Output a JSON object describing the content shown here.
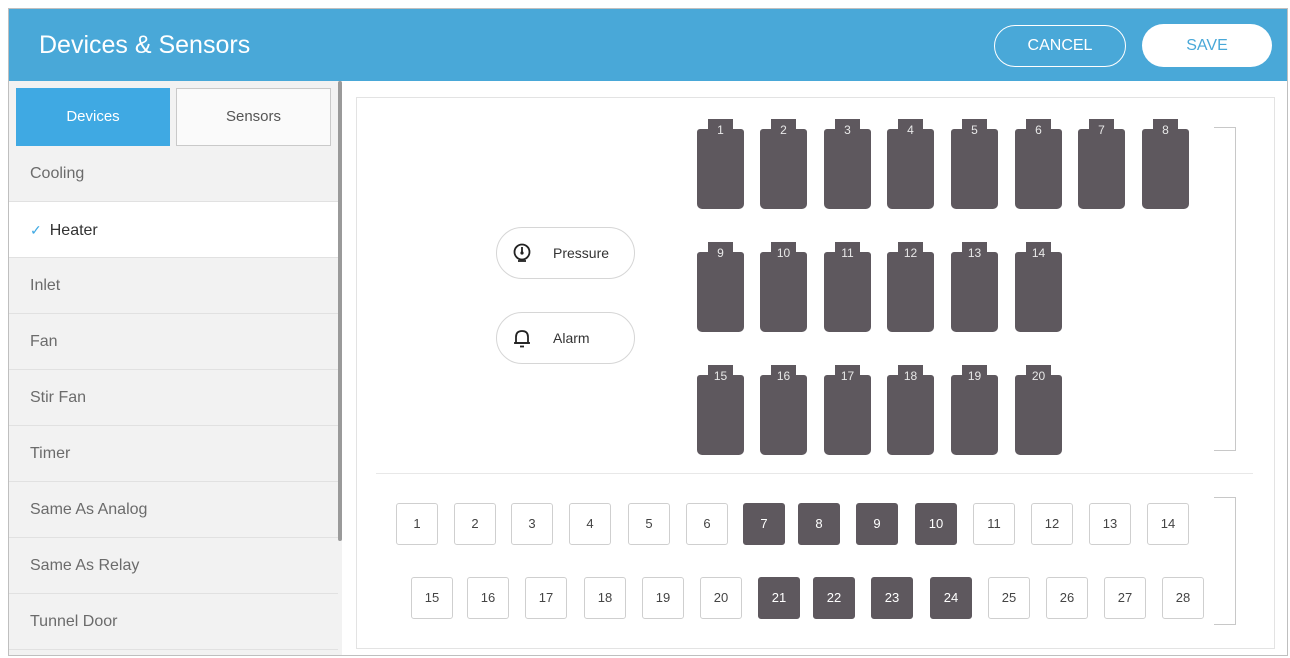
{
  "header": {
    "title": "Devices & Sensors",
    "cancel_label": "CANCEL",
    "save_label": "SAVE"
  },
  "colors": {
    "header_bg": "#49a8d8",
    "active_tab": "#3fa9e3",
    "device_fill": "#5e585e"
  },
  "sidebar": {
    "tabs": [
      {
        "label": "Devices",
        "selected": true
      },
      {
        "label": "Sensors",
        "selected": false
      }
    ],
    "selected_mark": "✓",
    "items": [
      {
        "label": "Cooling",
        "selected": false
      },
      {
        "label": "Heater",
        "selected": true
      },
      {
        "label": "Inlet",
        "selected": false
      },
      {
        "label": "Fan",
        "selected": false
      },
      {
        "label": "Stir Fan",
        "selected": false
      },
      {
        "label": "Timer",
        "selected": false
      },
      {
        "label": "Same As Analog",
        "selected": false
      },
      {
        "label": "Same As Relay",
        "selected": false
      },
      {
        "label": "Tunnel Door",
        "selected": false
      }
    ]
  },
  "sensors": {
    "pressure": {
      "label": "Pressure",
      "icon": "pressure-gauge-icon"
    },
    "alarm": {
      "label": "Alarm",
      "icon": "bell-icon"
    }
  },
  "devices": [
    [
      "1",
      "2",
      "3",
      "4",
      "5",
      "6",
      "7",
      "8"
    ],
    [
      "9",
      "10",
      "11",
      "12",
      "13",
      "14"
    ],
    [
      "15",
      "16",
      "17",
      "18",
      "19",
      "20"
    ]
  ],
  "relays": {
    "row1": [
      "1",
      "2",
      "3",
      "4",
      "5",
      "6",
      "7",
      "8",
      "9",
      "10",
      "11",
      "12",
      "13",
      "14"
    ],
    "row2": [
      "15",
      "16",
      "17",
      "18",
      "19",
      "20",
      "21",
      "22",
      "23",
      "24",
      "25",
      "26",
      "27",
      "28"
    ],
    "selected": [
      "7",
      "8",
      "9",
      "10",
      "21",
      "22",
      "23",
      "24"
    ]
  }
}
